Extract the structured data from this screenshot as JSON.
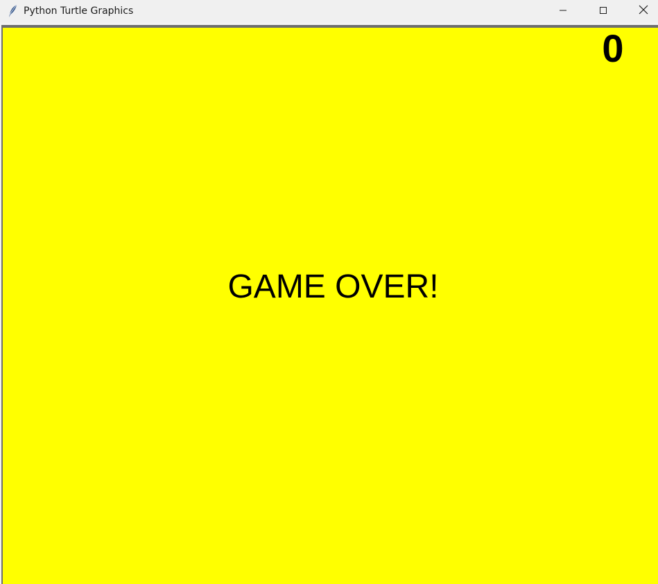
{
  "window": {
    "title": "Python Turtle Graphics",
    "app_icon": "feather-icon",
    "controls": {
      "minimize_icon": "minimize-icon",
      "maximize_icon": "maximize-icon",
      "close_icon": "close-icon"
    }
  },
  "canvas": {
    "background_color": "#ffff00",
    "text_color": "#000000",
    "score": "0",
    "message": "GAME OVER!"
  }
}
